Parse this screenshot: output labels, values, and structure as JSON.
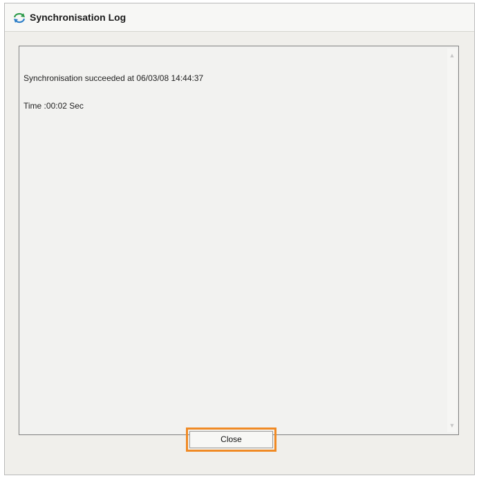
{
  "window": {
    "title": "Synchronisation Log",
    "icon": "sync-icon"
  },
  "log": {
    "lines": [
      "Synchronisation succeeded at 06/03/08 14:44:37",
      "Time :00:02 Sec"
    ]
  },
  "footer": {
    "close_label": "Close"
  },
  "colors": {
    "focus_outline": "#f08a24",
    "sync_icon_green": "#2e9b4b",
    "sync_icon_blue": "#2e7fc8"
  }
}
